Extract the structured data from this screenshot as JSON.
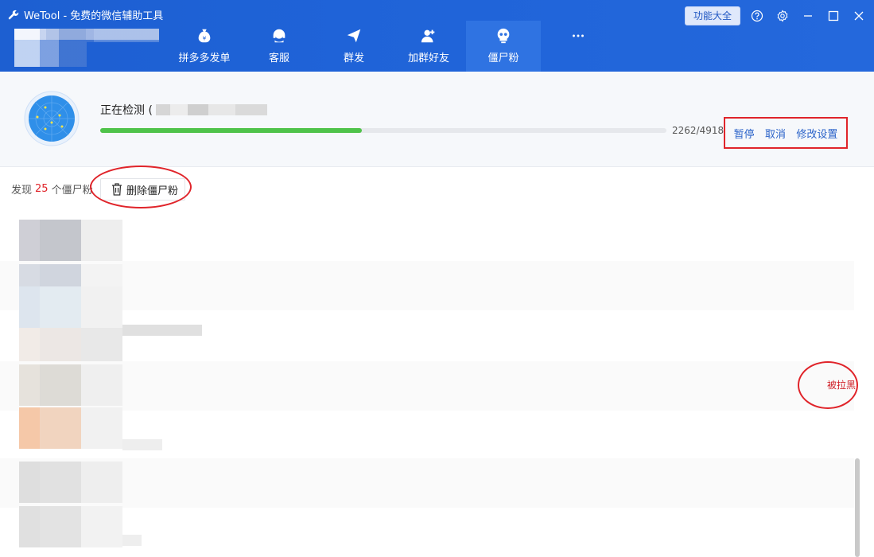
{
  "app": {
    "title": "WeTool - 免费的微信辅助工具"
  },
  "nav": {
    "items": [
      {
        "label": "拼多多发单",
        "icon": "money-bag-icon"
      },
      {
        "label": "客服",
        "icon": "headset-icon"
      },
      {
        "label": "群发",
        "icon": "send-icon"
      },
      {
        "label": "加群好友",
        "icon": "add-friend-icon"
      },
      {
        "label": "僵尸粉",
        "icon": "skull-icon",
        "active": true
      },
      {
        "label": "",
        "icon": "more-icon"
      }
    ]
  },
  "topbar": {
    "func_label": "功能大全"
  },
  "detect": {
    "title_prefix": "正在检测 (",
    "progress_fraction": 0.4623,
    "count_text": "2262/4918",
    "actions": {
      "pause": "暂停",
      "cancel": "取消",
      "settings": "修改设置"
    }
  },
  "found": {
    "prefix": "发现",
    "count": "25",
    "suffix": "个僵尸粉",
    "delete_label": "删除僵尸粉"
  },
  "list": {
    "status_label": "被拉黑"
  },
  "colors": {
    "accent": "#1f63d8",
    "progress": "#4fc34a",
    "highlight": "#e0242a",
    "link": "#2a62c9"
  }
}
